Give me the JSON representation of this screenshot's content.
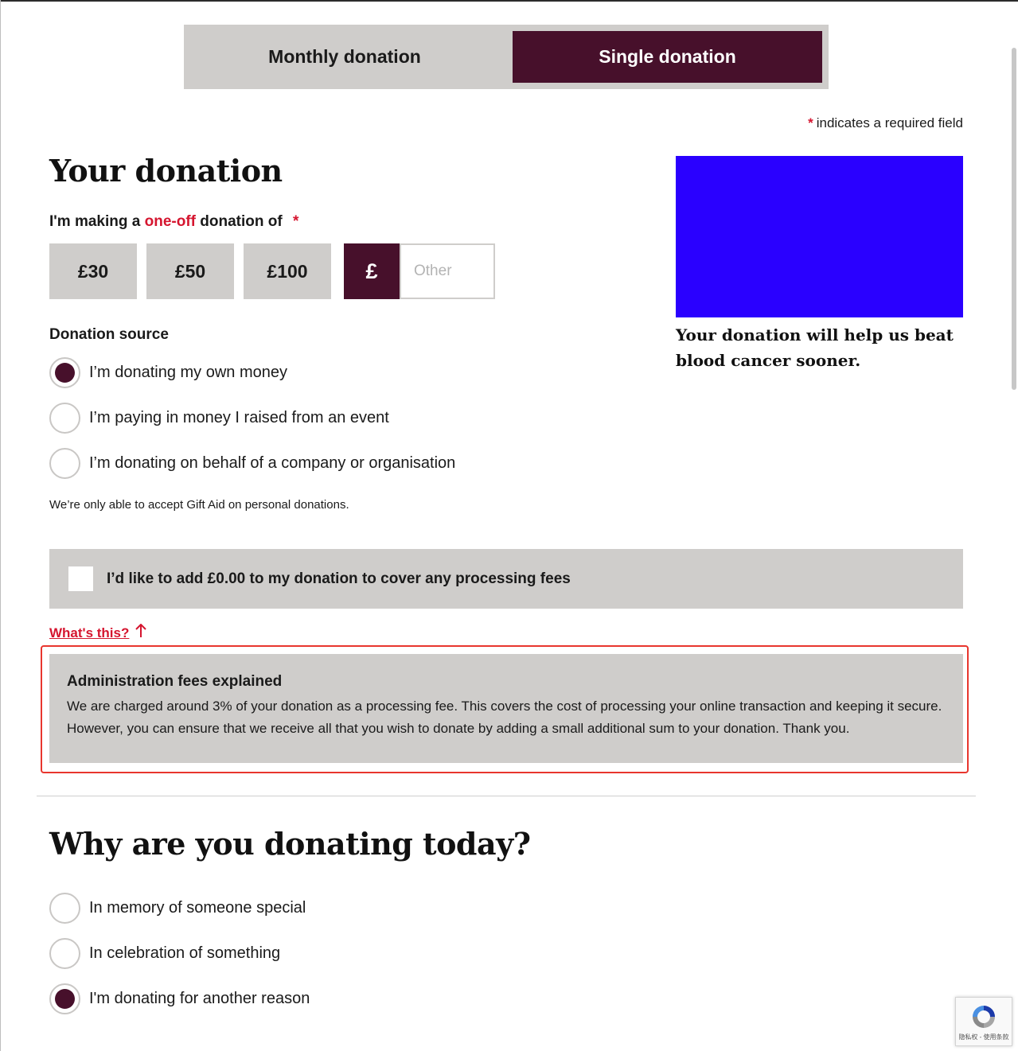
{
  "toggle": {
    "monthly_label": "Monthly donation",
    "single_label": "Single donation",
    "selected": "single"
  },
  "required_note": {
    "star": "*",
    "text": "indicates a required field"
  },
  "donation": {
    "heading": "Your donation",
    "amount_label_prefix": "I'm making a",
    "amount_label_accent": "one-off",
    "amount_label_suffix": "donation of",
    "required_star": "*",
    "amounts": [
      "£30",
      "£50",
      "£100"
    ],
    "currency_symbol": "£",
    "other_placeholder": "Other",
    "other_value": ""
  },
  "source": {
    "label": "Donation source",
    "options": [
      {
        "label": "I’m donating my own money",
        "checked": true
      },
      {
        "label": "I’m paying in money I raised from an event",
        "checked": false
      },
      {
        "label": "I’m donating on behalf of a company or organisation",
        "checked": false
      }
    ],
    "gift_aid_note": "We’re only able to accept Gift Aid on personal donations."
  },
  "fees": {
    "checkbox_label": "I’d like to add £0.00 to my donation to cover any processing fees",
    "checked": false,
    "whats_this": "What's this?",
    "arrow_icon": "arrow-up-icon",
    "explain_title": "Administration fees explained",
    "explain_body": "We are charged around 3% of your donation as a processing fee. This covers the cost of processing your online transaction and keeping it secure. However, you can ensure that we receive all that you wish to donate by adding a small additional sum to your donation. Thank you."
  },
  "reason": {
    "heading": "Why are you donating today?",
    "options": [
      {
        "label": "In memory of someone special",
        "checked": false
      },
      {
        "label": "In celebration of something",
        "checked": false
      },
      {
        "label": "I'm donating for another reason",
        "checked": true
      }
    ]
  },
  "promo": {
    "text": "Your donation will help us beat blood cancer sooner."
  },
  "recaptcha": {
    "links": "隐私权 - 使用条款"
  },
  "colors": {
    "brand": "#47102b",
    "accent": "#d5152f",
    "panel": "#cfcdcb",
    "promo_blue": "#2a00ff"
  }
}
